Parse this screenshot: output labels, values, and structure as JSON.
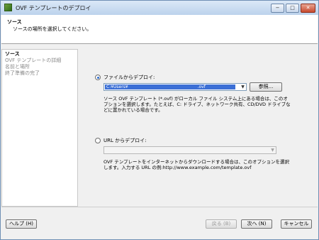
{
  "window": {
    "title": "OVF テンプレートのデプロイ",
    "minimize": "−",
    "maximize": "□",
    "close": "✕"
  },
  "header": {
    "title": "ソース",
    "subtitle": "ソースの場所を選択してください。"
  },
  "steps": [
    {
      "label": "ソース"
    },
    {
      "label": "OVF テンプレートの詳細"
    },
    {
      "label": "名前と場所"
    },
    {
      "label": "終了準備の完了"
    }
  ],
  "file_option": {
    "label": "ファイルからデプロイ:",
    "value": "C:¥Users¥",
    "value_suffix": ".ovf",
    "browse_label": "参照...",
    "description": "ソース OVF テンプレート (*.ovf) がローカル ファイル システム上にある場合は、このオプションを選択します。たとえば、C: ドライブ、ネットワーク共有、CD/DVD ドライブなどに置かれている場合です。"
  },
  "url_option": {
    "label": "URL からデプロイ:",
    "value": "",
    "description": "OVF テンプレートをインターネットからダウンロードする場合は、このオプションを選択します。入力する URL の例:http://www.example.com/template.ovf"
  },
  "footer": {
    "help": "ヘルプ (H)",
    "back": "戻る (B)",
    "next": "次へ (N)",
    "cancel": "キャンセル"
  }
}
